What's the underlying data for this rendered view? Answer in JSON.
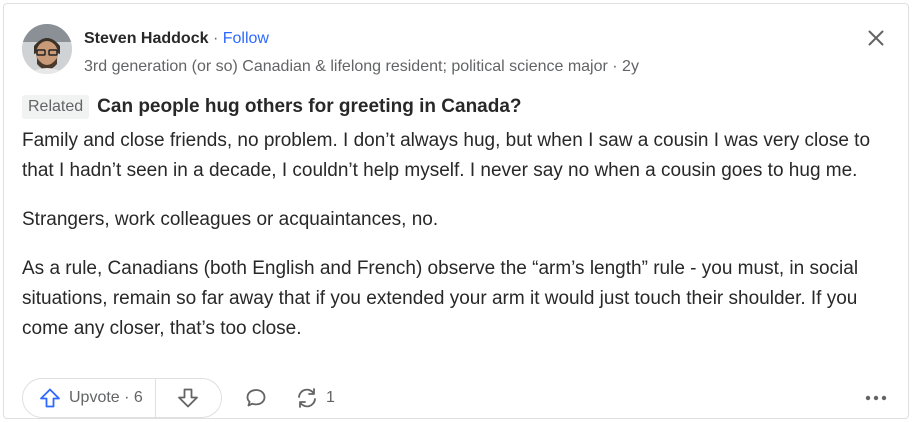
{
  "author": {
    "name": "Steven Haddock",
    "separator": "·",
    "follow_label": "Follow",
    "credential": "3rd generation (or so) Canadian & lifelong resident; political science major · 2y"
  },
  "question": {
    "badge": "Related",
    "title": "Can people hug others for greeting in Canada?"
  },
  "answer": {
    "paragraphs": [
      "Family and close friends, no problem. I don’t always hug, but when I saw a cousin I was very close to that I hadn’t seen in a decade, I couldn’t help myself. I never say no when a cousin goes to hug me.",
      "Strangers, work colleagues or acquaintances, no.",
      "As a rule, Canadians (both English and French) observe the “arm’s length” rule - you must, in social situations, remain so far away that if you extended your arm it would just touch their shoulder. If you come any closer, that’s too close."
    ]
  },
  "actions": {
    "upvote_label": "Upvote · 6",
    "share_count": "1"
  },
  "icons": {
    "close": "close-icon",
    "upvote": "upvote-arrow-icon",
    "downvote": "downvote-arrow-icon",
    "comment": "comment-bubble-icon",
    "share": "share-arrows-icon",
    "more": "more-dots-icon"
  },
  "colors": {
    "accent": "#2e69ff",
    "text": "#282829",
    "muted": "#636466",
    "border": "#dee0e1"
  }
}
